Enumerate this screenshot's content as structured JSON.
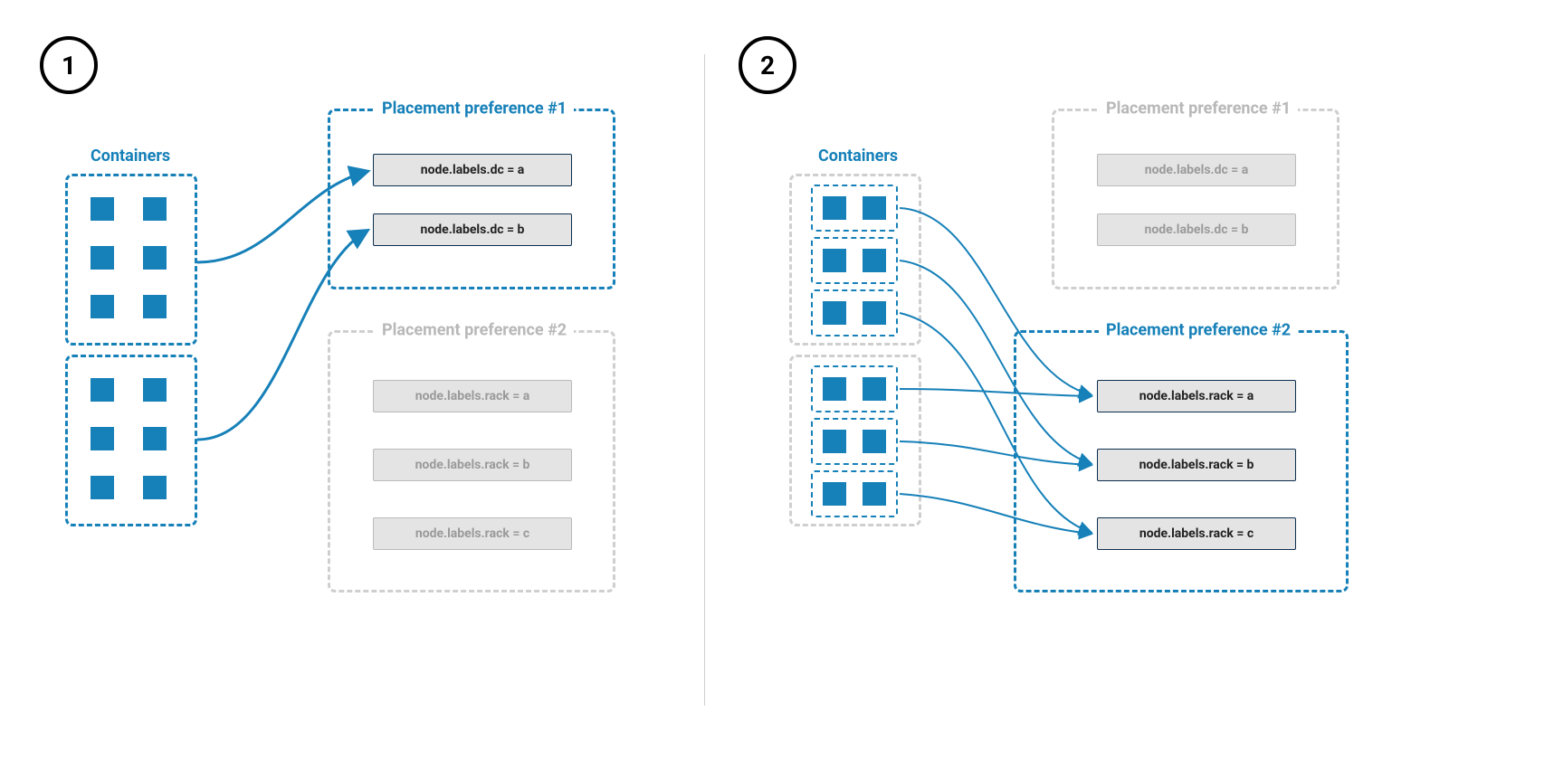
{
  "colors": {
    "accent": "#1680b8",
    "muted": "#b8b8b8"
  },
  "left": {
    "step": "1",
    "containers_title": "Containers",
    "pref1": {
      "title": "Placement preference #1",
      "labels": [
        "node.labels.dc = a",
        "node.labels.dc = b"
      ]
    },
    "pref2": {
      "title": "Placement preference #2",
      "labels": [
        "node.labels.rack = a",
        "node.labels.rack = b",
        "node.labels.rack = c"
      ]
    }
  },
  "right": {
    "step": "2",
    "containers_title": "Containers",
    "pref1": {
      "title": "Placement preference #1",
      "labels": [
        "node.labels.dc = a",
        "node.labels.dc = b"
      ]
    },
    "pref2": {
      "title": "Placement preference #2",
      "labels": [
        "node.labels.rack = a",
        "node.labels.rack = b",
        "node.labels.rack = c"
      ]
    }
  }
}
